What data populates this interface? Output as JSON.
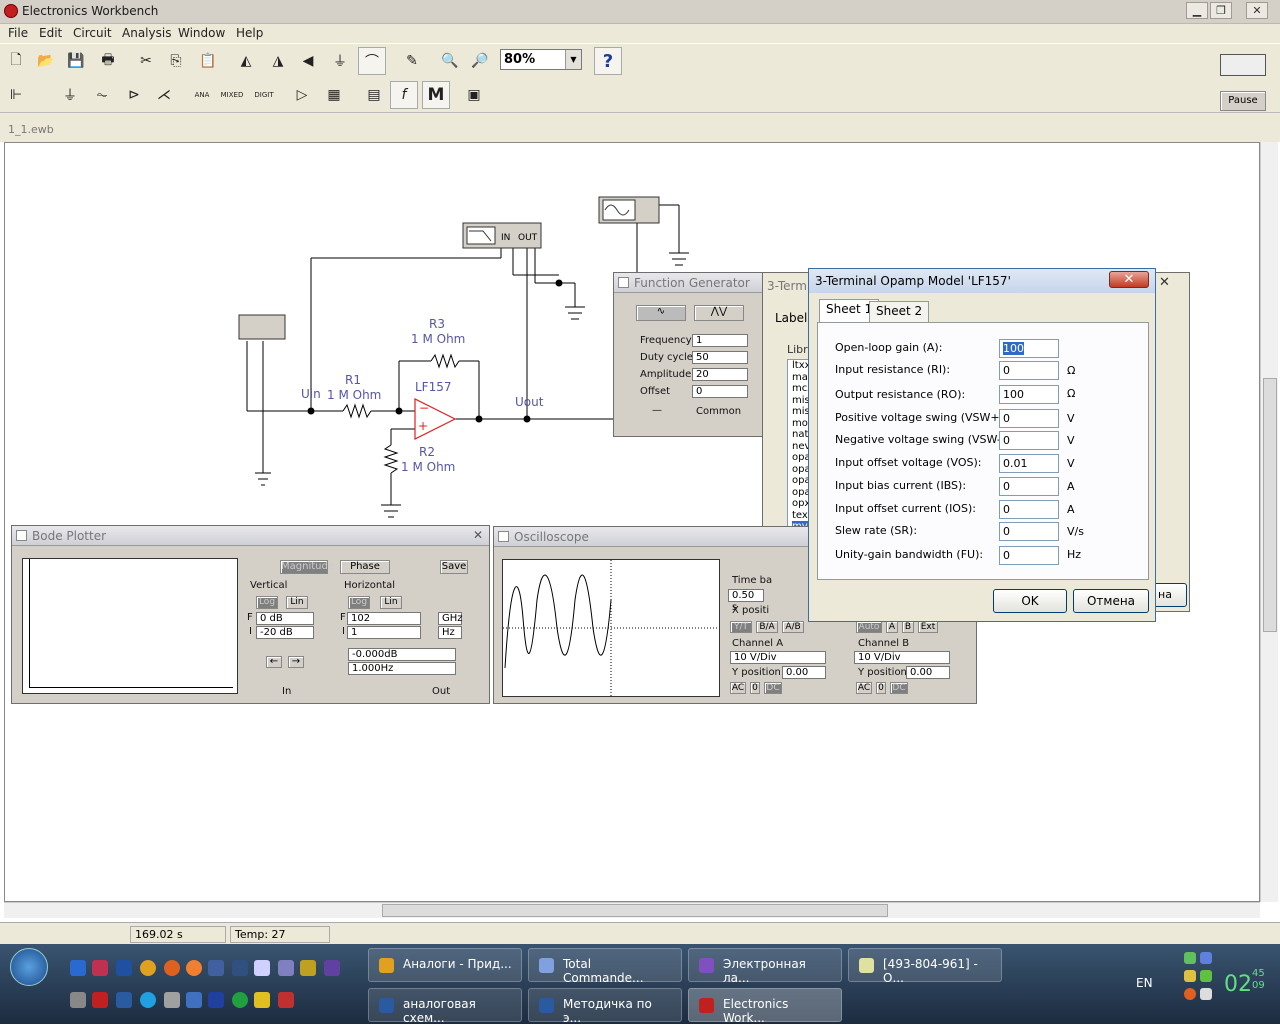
{
  "app": {
    "title": "Electronics Workbench",
    "doc_title": "1_1.ewb"
  },
  "menu": [
    "File",
    "Edit",
    "Circuit",
    "Analysis",
    "Window",
    "Help"
  ],
  "toolbar": {
    "zoom": "80%",
    "pause": "Pause",
    "help": "?",
    "parts_ana": "ANA",
    "parts_mixed": "MIXED",
    "parts_digit": "DIGIT",
    "parts_m": "M",
    "parts_f": "f"
  },
  "schematic": {
    "labels": {
      "uin": "Uin",
      "uout": "Uout",
      "r1": "R1",
      "r1v": "1 M Ohm",
      "r2": "R2",
      "r2v": "1 M Ohm",
      "r3": "R3",
      "r3v": "1 M Ohm",
      "opamp": "LF157",
      "bode_in": "IN",
      "bode_out": "OUT",
      "opamp_minus": "−",
      "opamp_plus": "+"
    }
  },
  "bode": {
    "title": "Bode Plotter",
    "magnitude": "Magnitude",
    "phase": "Phase",
    "save": "Save",
    "vertical": "Vertical",
    "horizontal": "Horizontal",
    "log": "Log",
    "lin": "Lin",
    "v_f_label": "F",
    "v_i_label": "I",
    "h_f_label": "F",
    "h_i_label": "I",
    "v_f": "0 dB",
    "v_i": "-20 dB",
    "h_f": "102",
    "h_f_unit": "GHz",
    "h_i": "1",
    "h_i_unit": "Hz",
    "readout_db": "-0.000dB",
    "readout_hz": "1.000Hz",
    "in": "In",
    "out": "Out"
  },
  "oscilloscope": {
    "title": "Oscilloscope",
    "time_base": "Time ba",
    "time_val": "0.50 s",
    "x_pos": "X positi",
    "yt": "Y/T",
    "ba": "B/A",
    "ab": "A/B",
    "chan_a": "Channel A",
    "chan_b": "Channel B",
    "a_vdiv": "10  V/Div",
    "b_vdiv": "10  V/Div",
    "y_position": "Y position",
    "a_ypos": "0.00",
    "b_ypos": "0.00",
    "ac": "AC",
    "zero": "0",
    "dc": "DC",
    "auto": "Auto",
    "a": "A",
    "b": "B",
    "ext": "Ext"
  },
  "fgen": {
    "title": "Function Generator",
    "frequency": "Frequency",
    "duty": "Duty cycle",
    "amplitude": "Amplitude",
    "offset": "Offset",
    "freq_val": "1",
    "duty_val": "50",
    "amp_val": "20",
    "off_val": "0",
    "minus": "—",
    "common": "Common"
  },
  "props_bg": {
    "title": "3-Term",
    "label_tab": "Label",
    "library": "Libra",
    "items": [
      "ltxx",
      "max",
      "mcx",
      "mis",
      "mis",
      "mot",
      "nat",
      "nev",
      "opa",
      "opa",
      "opa",
      "opa",
      "opx",
      "tex",
      "my"
    ],
    "cancel_tail": "на"
  },
  "dialog": {
    "title": "3-Terminal Opamp Model 'LF157'",
    "tab1": "Sheet 1",
    "tab2": "Sheet 2",
    "fields": [
      {
        "label": "Open-loop gain (A):",
        "value": "100",
        "unit": ""
      },
      {
        "label": "Input resistance (RI):",
        "value": "0",
        "unit": "Ω"
      },
      {
        "label": "Output resistance (RO):",
        "value": "100",
        "unit": "Ω"
      },
      {
        "label": "Positive voltage swing (VSW+):",
        "value": "0",
        "unit": "V"
      },
      {
        "label": "Negative voltage swing (VSW-):",
        "value": "0",
        "unit": "V"
      },
      {
        "label": "Input offset voltage (VOS):",
        "value": "0.01",
        "unit": "V"
      },
      {
        "label": "Input bias current (IBS):",
        "value": "0",
        "unit": "A"
      },
      {
        "label": "Input offset current (IOS):",
        "value": "0",
        "unit": "A"
      },
      {
        "label": "Slew rate (SR):",
        "value": "0",
        "unit": "V/s"
      },
      {
        "label": "Unity-gain bandwidth (FU):",
        "value": "0",
        "unit": "Hz"
      }
    ],
    "ok": "OK",
    "cancel": "Отмена"
  },
  "status": {
    "time": "169.02 s",
    "temp": "Temp:  27"
  },
  "taskbar": {
    "tasks_top": [
      "Аналоги - Прид...",
      "Total Commande...",
      "Электронная ла...",
      "[493-804-961] - О..."
    ],
    "tasks_bottom": [
      "аналоговая схем...",
      "Методичка по э...",
      "Electronics Work..."
    ],
    "lang": "EN",
    "clock": "02",
    "clock_min": "45",
    "clock_sec": "09"
  },
  "colors": {
    "wire": "#000000",
    "component_label": "#5555aa",
    "opamp": "#e02020",
    "accent": "#3a6ea5"
  }
}
